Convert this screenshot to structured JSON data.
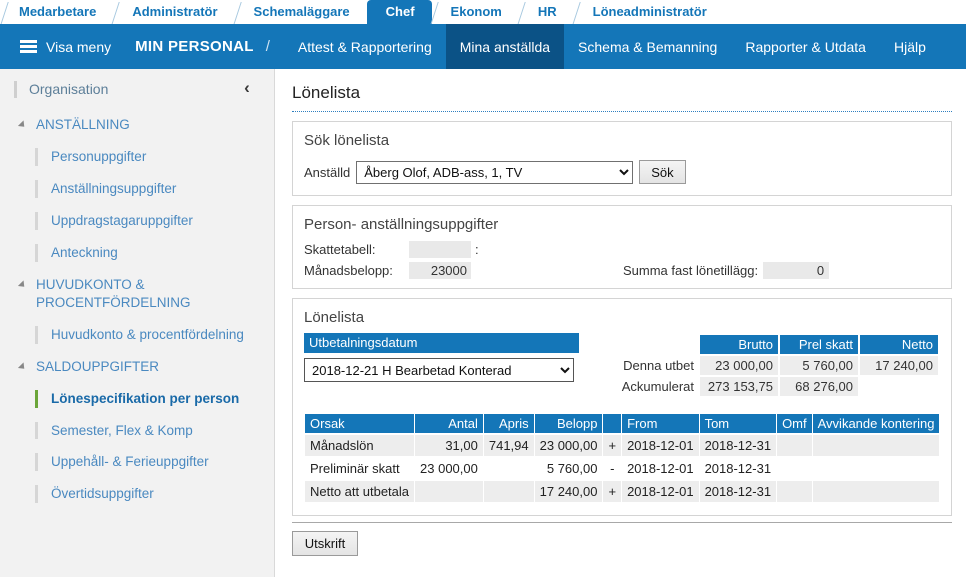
{
  "role_tabs": [
    {
      "label": "Medarbetare",
      "active": false
    },
    {
      "label": "Administratör",
      "active": false
    },
    {
      "label": "Schemaläggare",
      "active": false
    },
    {
      "label": "Chef",
      "active": true
    },
    {
      "label": "Ekonom",
      "active": false
    },
    {
      "label": "HR",
      "active": false
    },
    {
      "label": "Löneadministratör",
      "active": false
    }
  ],
  "navbar": {
    "menu_label": "Visa meny",
    "brand": "MIN PERSONAL",
    "separator": "/",
    "items": [
      {
        "label": "Attest & Rapportering",
        "active": false
      },
      {
        "label": "Mina anställda",
        "active": true
      },
      {
        "label": "Schema & Bemanning",
        "active": false
      },
      {
        "label": "Rapporter & Utdata",
        "active": false
      },
      {
        "label": "Hjälp",
        "active": false
      }
    ]
  },
  "sidebar": {
    "header": "Organisation",
    "collapse_icon": "‹",
    "nodes": [
      {
        "type": "group",
        "label": "ANSTÄLLNING"
      },
      {
        "type": "item",
        "label": "Personuppgifter",
        "active": false
      },
      {
        "type": "item",
        "label": "Anställningsuppgifter",
        "active": false
      },
      {
        "type": "item",
        "label": "Uppdragstagaruppgifter",
        "active": false
      },
      {
        "type": "item",
        "label": "Anteckning",
        "active": false
      },
      {
        "type": "group",
        "label": "HUVUDKONTO & PROCENTFÖRDELNING"
      },
      {
        "type": "item",
        "label": "Huvudkonto & procentfördelning",
        "active": false
      },
      {
        "type": "group",
        "label": "SALDOUPPGIFTER"
      },
      {
        "type": "item",
        "label": "Lönespecifikation per person",
        "active": true
      },
      {
        "type": "item",
        "label": "Semester, Flex & Komp",
        "active": false
      },
      {
        "type": "item",
        "label": "Uppehåll- & Ferieuppgifter",
        "active": false
      },
      {
        "type": "item",
        "label": "Övertidsuppgifter",
        "active": false
      }
    ]
  },
  "main": {
    "page_title": "Lönelista",
    "search_panel": {
      "title": "Sök lönelista",
      "employee_label": "Anställd",
      "employee_value": "Åberg Olof, ADB-ass, 1, TV",
      "search_button": "Sök"
    },
    "person_panel": {
      "title": "Person- anställningsuppgifter",
      "tax_table_label": "Skattetabell:",
      "tax_table_value": "",
      "tax_table_suffix": ":",
      "monthly_label": "Månadsbelopp:",
      "monthly_value": "23000",
      "fixed_supplement_label": "Summa fast lönetillägg:",
      "fixed_supplement_value": "0"
    },
    "payroll_panel": {
      "title": "Lönelista",
      "date_header": "Utbetalningsdatum",
      "date_value": "2018-12-21 H Bearbetad Konterad",
      "summary": {
        "columns": [
          "Brutto",
          "Prel skatt",
          "Netto"
        ],
        "rows": [
          {
            "label": "Denna utbet",
            "values": [
              "23 000,00",
              "5 760,00",
              "17 240,00"
            ]
          },
          {
            "label": "Ackumulerat",
            "values": [
              "273 153,75",
              "68 276,00",
              ""
            ]
          }
        ]
      },
      "detail": {
        "columns": [
          "Orsak",
          "Antal",
          "Apris",
          "Belopp",
          "",
          "From",
          "Tom",
          "Omf",
          "Avvikande kontering"
        ],
        "rows": [
          {
            "orsak": "Månadslön",
            "antal": "31,00",
            "apris": "741,94",
            "belopp": "23 000,00",
            "sign": "+",
            "from": "2018-12-01",
            "tom": "2018-12-31",
            "omf": "",
            "kontering": ""
          },
          {
            "orsak": "Preliminär skatt",
            "antal": "23 000,00",
            "apris": "",
            "belopp": "5 760,00",
            "sign": "-",
            "from": "2018-12-01",
            "tom": "2018-12-31",
            "omf": "",
            "kontering": ""
          },
          {
            "orsak": "Netto att utbetala",
            "antal": "",
            "apris": "",
            "belopp": "17 240,00",
            "sign": "+",
            "from": "2018-12-01",
            "tom": "2018-12-31",
            "omf": "",
            "kontering": ""
          }
        ]
      },
      "print_button": "Utskrift"
    }
  },
  "colors": {
    "brand_blue": "#1476b8",
    "nav_active": "#0b5286",
    "accent_green": "#6ba539",
    "link_blue": "#4a89c0"
  }
}
